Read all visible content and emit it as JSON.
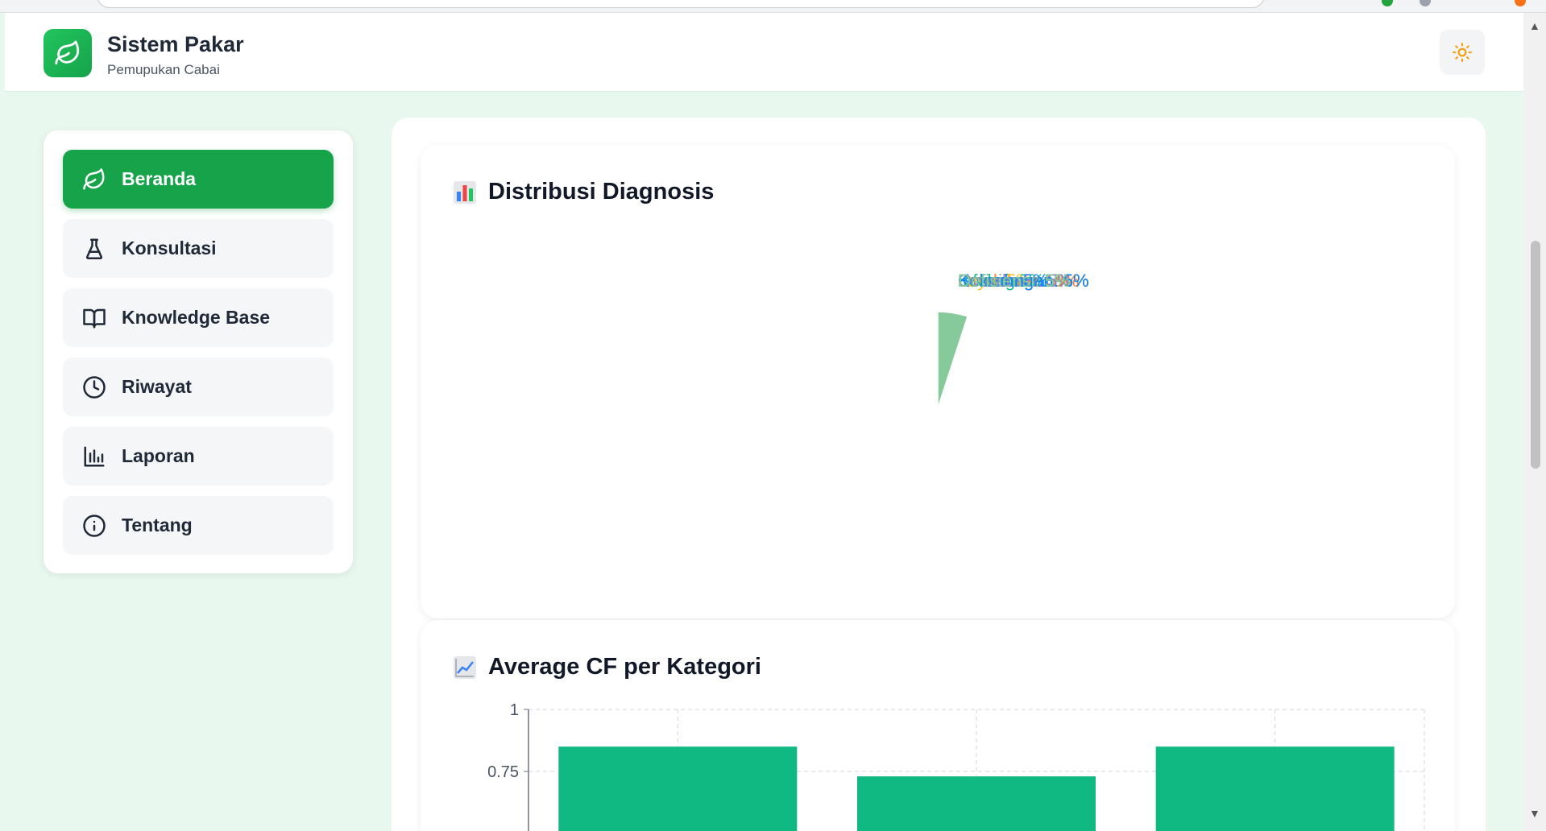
{
  "app": {
    "title": "Sistem Pakar",
    "subtitle": "Pemupukan Cabai",
    "brand_color": "#16a34a"
  },
  "header": {
    "theme_toggle_icon": "sun-icon"
  },
  "sidebar": {
    "items": [
      {
        "label": "Beranda",
        "icon": "leaf-icon",
        "active": true
      },
      {
        "label": "Konsultasi",
        "icon": "flask-icon",
        "active": false
      },
      {
        "label": "Knowledge Base",
        "icon": "book-icon",
        "active": false
      },
      {
        "label": "Riwayat",
        "icon": "clock-icon",
        "active": false
      },
      {
        "label": "Laporan",
        "icon": "bar-chart-icon",
        "active": false
      },
      {
        "label": "Tentang",
        "icon": "info-icon",
        "active": false
      }
    ]
  },
  "cards": {
    "pie_title": "Distribusi Diagnosis",
    "pie_icon": "bar-chart-emoji-icon",
    "bar_title": "Average CF per Kategori",
    "bar_icon": "trend-chart-emoji-icon"
  },
  "chart_data": [
    {
      "type": "pie",
      "title": "Distribusi Diagnosis",
      "slices": [
        {
          "label": "Kekurangan: 5%",
          "value": 5,
          "color": "#8b80d9"
        },
        {
          "label": "Kelebihan: 5%",
          "value": 5,
          "color": "#fb7c3c"
        },
        {
          "label": "Kekurangan: 5%",
          "value": 5,
          "color": "#fbbf24"
        },
        {
          "label": "Kekurangan: 5%",
          "value": 5,
          "color": "#10c08a"
        },
        {
          "label": "Kekurangan: 5%",
          "value": 5,
          "color": "#0a84ff"
        },
        {
          "label": "Infeksi: 5%",
          "value": 5,
          "color": "#10c08a"
        },
        {
          "label": "Kekurangan: 5%",
          "value": 5,
          "color": "#0a84ff"
        },
        {
          "label": "Defisiensi: 5%",
          "value": 5,
          "color": "#86c99a"
        },
        {
          "label": "Defisiensi: 5%",
          "value": 5,
          "color": "#8b80d9"
        },
        {
          "label": "Keracunan: 5%",
          "value": 5,
          "color": "#fb7c3c"
        },
        {
          "label": "Layu: 5%",
          "value": 5,
          "color": "#fbbf24"
        },
        {
          "label": "Serangan: 5%",
          "value": 5,
          "color": "#10c08a"
        },
        {
          "label": "Bercak: 5%",
          "value": 5,
          "color": "#0a84ff"
        },
        {
          "label": "Overdosis: 5%",
          "value": 5,
          "color": "#86c99a"
        },
        {
          "label": "Overdosis: 5%",
          "value": 5,
          "color": "#8b80d9"
        },
        {
          "label": "Kekurangan: 5%",
          "value": 5,
          "color": "#fb7c3c"
        },
        {
          "label": "Kekurangan: 5%",
          "value": 5,
          "color": "#fbbf24"
        },
        {
          "label": "Defisiensi: 5%",
          "value": 5,
          "color": "#10c08a"
        },
        {
          "label": "Kekurangan: 5%",
          "value": 5,
          "color": "#0a84ff"
        },
        {
          "label": "Defisiensi: 5%",
          "value": 5,
          "color": "#86c99a"
        }
      ]
    },
    {
      "type": "bar",
      "title": "Average CF per Kategori",
      "values": [
        0.85,
        0.73,
        0.85
      ],
      "ylim": [
        0,
        1
      ],
      "yticks": [
        "1",
        "0.75"
      ],
      "bar_color": "#10b981",
      "grid": true
    }
  ]
}
